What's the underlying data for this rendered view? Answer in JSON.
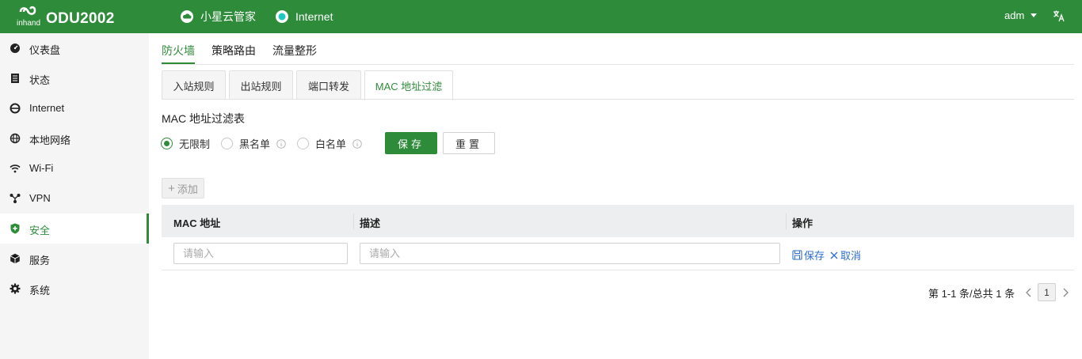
{
  "header": {
    "logo_text": "ODU2002",
    "logo_small": "inhand",
    "cloud_label": "小星云管家",
    "internet_label": "Internet",
    "user": "adm",
    "brand_color": "#2e8b3a"
  },
  "sidebar": {
    "items": [
      {
        "label": "仪表盘",
        "icon": "dashboard-icon"
      },
      {
        "label": "状态",
        "icon": "status-icon"
      },
      {
        "label": "Internet",
        "icon": "internet-icon"
      },
      {
        "label": "本地网络",
        "icon": "globe-icon"
      },
      {
        "label": "Wi-Fi",
        "icon": "wifi-icon"
      },
      {
        "label": "VPN",
        "icon": "vpn-icon"
      },
      {
        "label": "安全",
        "icon": "shield-icon",
        "active": true
      },
      {
        "label": "服务",
        "icon": "cube-icon"
      },
      {
        "label": "系统",
        "icon": "gear-icon"
      }
    ]
  },
  "top_tabs": [
    {
      "label": "防火墙",
      "active": true
    },
    {
      "label": "策略路由"
    },
    {
      "label": "流量整形"
    }
  ],
  "card_tabs": [
    {
      "label": "入站规则"
    },
    {
      "label": "出站规则"
    },
    {
      "label": "端口转发"
    },
    {
      "label": "MAC 地址过滤",
      "active": true
    }
  ],
  "section": {
    "title": "MAC 地址过滤表",
    "radios": [
      {
        "label": "无限制",
        "checked": true
      },
      {
        "label": "黑名单",
        "checked": false
      },
      {
        "label": "白名单",
        "checked": false
      }
    ],
    "save_label": "保存",
    "reset_label": "重置"
  },
  "add_label": "添加",
  "table": {
    "headers": [
      "MAC 地址",
      "描述",
      "操作"
    ],
    "row": {
      "mac_placeholder": "请输入",
      "desc_placeholder": "请输入",
      "save_action": "保存",
      "cancel_action": "取消"
    }
  },
  "pagination": {
    "summary": "第 1-1 条/总共 1 条",
    "current_page": "1"
  }
}
